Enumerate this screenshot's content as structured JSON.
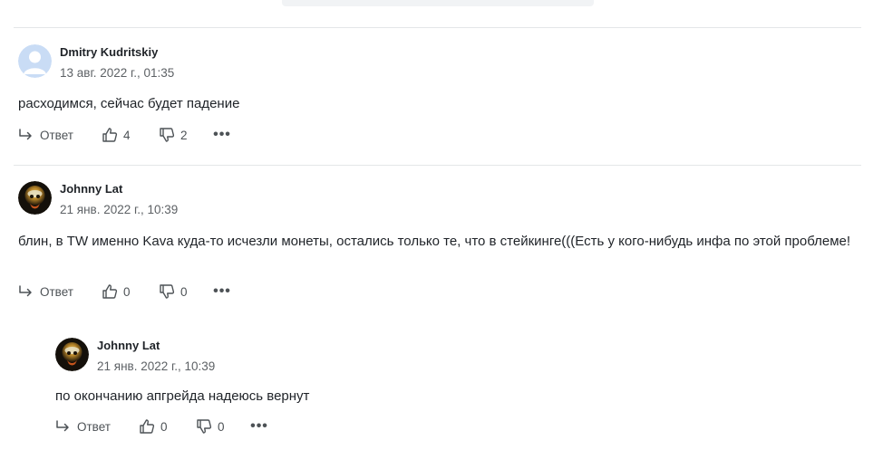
{
  "comments": [
    {
      "author": "Dmitry Kudritskiy",
      "date": "13 авг. 2022 г., 01:35",
      "text": "расходимся, сейчас будет падение",
      "reply_label": "Ответ",
      "likes": "4",
      "dislikes": "2",
      "avatar": "default-user-icon"
    },
    {
      "author": "Johnny Lat",
      "date": "21 янв. 2022 г., 10:39",
      "text": "блин, в TW именно Kava куда-то исчезли монеты, остались только те, что в стейкинге(((Есть у кого-нибудь инфа по этой проблеме!",
      "reply_label": "Ответ",
      "likes": "0",
      "dislikes": "0",
      "avatar": "user-photo"
    },
    {
      "author": "Johnny Lat",
      "date": "21 янв. 2022 г., 10:39",
      "text": "по окончанию апгрейда надеюсь вернут",
      "reply_label": "Ответ",
      "likes": "0",
      "dislikes": "0",
      "avatar": "user-photo"
    }
  ],
  "icons": {
    "reply": "reply-arrow-icon",
    "like": "thumbs-up-icon",
    "dislike": "thumbs-down-icon",
    "more": "more-dots-icon"
  },
  "more_label": "•••",
  "colors": {
    "text": "#1f2328",
    "muted": "#5d6165",
    "divider": "#e4e6e8",
    "default_avatar": "#c9dcf5"
  }
}
